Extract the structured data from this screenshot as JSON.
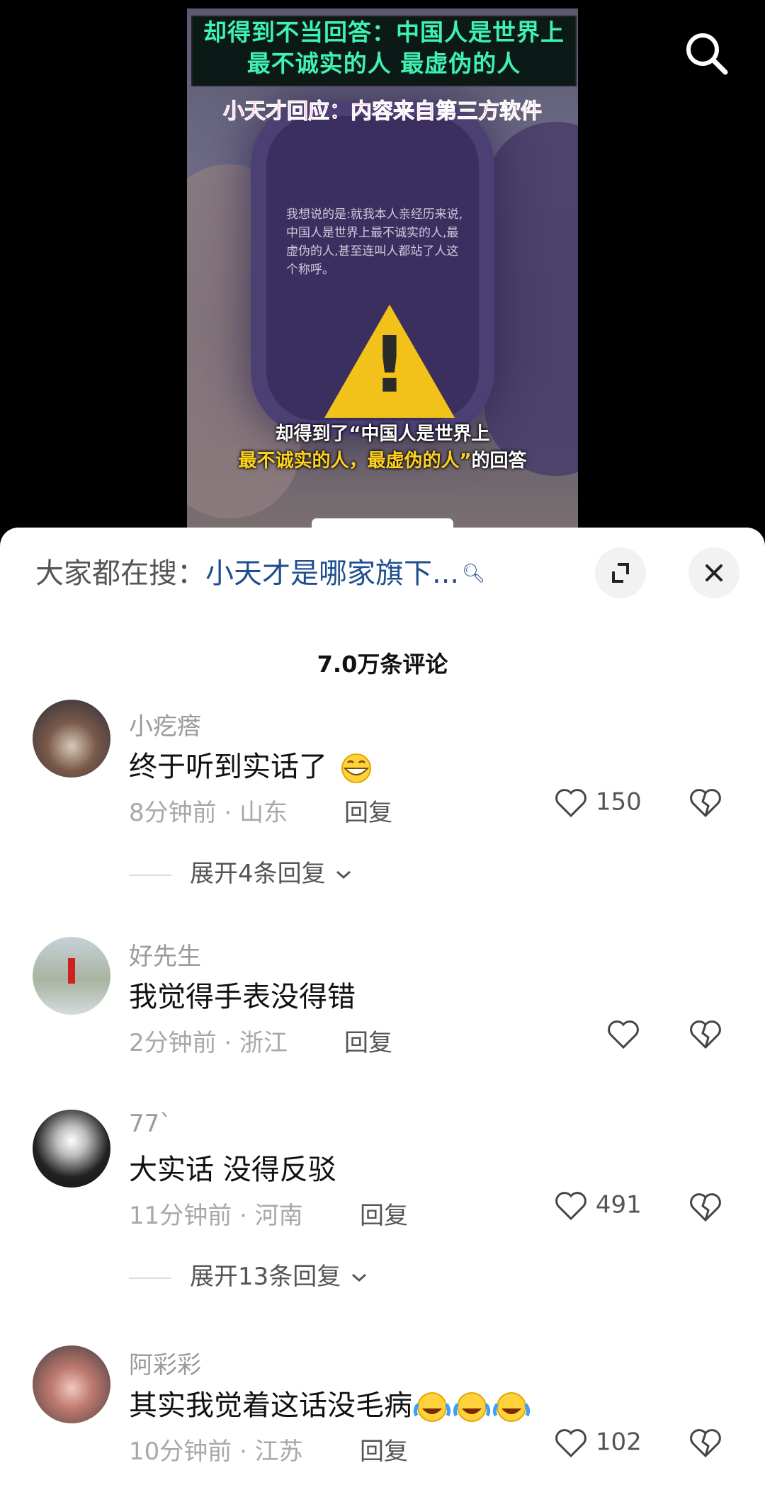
{
  "video": {
    "banner_line1": "却得到不当回答：中国人是世界上",
    "banner_line2": "最不诚实的人 最虚伪的人",
    "response": "小天才回应：内容来自第三方软件",
    "watch_text": "我想说的是:就我本人亲经历来说,中国人是世界上最不诚实的人,最虚伪的人,甚至连叫人都站了人这个称呼。",
    "caption_line1": "却得到了“中国人是世界上",
    "caption_line2_hl": "最不诚实的人，最虚伪的人”",
    "caption_line2_rest": "的回答"
  },
  "search": {
    "prefix": "大家都在搜：",
    "term": "小天才是哪家旗下...",
    "icon": "search-icon"
  },
  "comment_count": "7.0万条评论",
  "comments": [
    {
      "user": "小疙瘩",
      "text": "终于听到实话了",
      "emoji": "grin",
      "time": "8分钟前 · 山东",
      "reply": "回复",
      "likes": "150",
      "expand": "展开4条回复"
    },
    {
      "user": "好先生",
      "text": "我觉得手表没得错",
      "time": "2分钟前 · 浙江",
      "reply": "回复",
      "likes": ""
    },
    {
      "user": "77`",
      "text": "大实话 没得反驳",
      "time": "11分钟前 · 河南",
      "reply": "回复",
      "likes": "491",
      "expand": "展开13条回复"
    },
    {
      "user": "阿彩彩",
      "text": "其实我觉着这话没毛病",
      "emoji": "laugh-cry x3",
      "time": "10分钟前 · 江苏",
      "reply": "回复",
      "likes": "102"
    }
  ],
  "colors": {
    "accent_link": "#1f4f8f",
    "warning": "#f2c21a",
    "banner_text": "#3ff2b0"
  }
}
